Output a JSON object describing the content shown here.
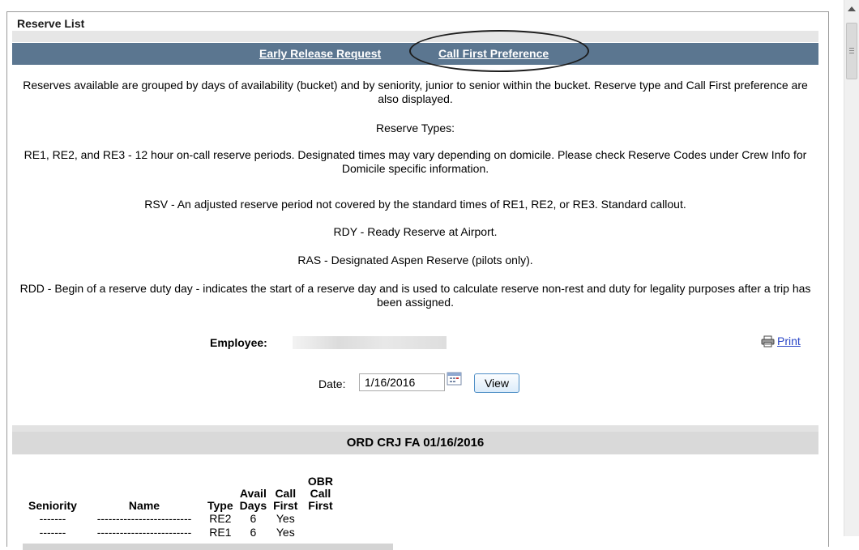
{
  "section_title": "Reserve List",
  "nav": {
    "early_release": "Early Release Request",
    "call_first": "Call First Preference"
  },
  "description": {
    "intro": "Reserves available are grouped by days of availability (bucket) and by seniority, junior to senior within the bucket. Reserve type and Call First preference are also displayed.",
    "types_heading": "Reserve Types:",
    "re_types": "RE1, RE2, and RE3 - 12 hour on-call reserve periods. Designated times may vary depending on domicile. Please check Reserve Codes under Crew Info for Domicile specific information.",
    "rsv": "RSV - An adjusted reserve period not covered by the standard times of RE1, RE2, or RE3. Standard callout.",
    "rdy": "RDY - Ready Reserve at Airport.",
    "ras": "RAS - Designated Aspen Reserve (pilots only).",
    "rdd": "RDD - Begin of a reserve duty day - indicates the start of a reserve day and is used to calculate reserve non-rest and duty for legality purposes after a trip has been assigned."
  },
  "employee": {
    "label": "Employee:"
  },
  "print_label": "Print",
  "date": {
    "label": "Date:",
    "value": "1/16/2016"
  },
  "view_button": "View",
  "report_header": "ORD CRJ FA   01/16/2016",
  "table": {
    "headers": {
      "seniority": "Seniority",
      "name": "Name",
      "type": "Type",
      "avail_top": "Avail",
      "avail_bottom": "Days",
      "call_top": "Call",
      "call_bottom": "First",
      "obr_top": "OBR Call",
      "obr_bottom": "First"
    },
    "rows": [
      {
        "seniority": "-------",
        "name": "-------------------------",
        "type": "RE2",
        "days": "6",
        "call_first": "Yes",
        "obr": ""
      },
      {
        "seniority": "-------",
        "name": "-------------------------",
        "type": "RE1",
        "days": "6",
        "call_first": "Yes",
        "obr": ""
      }
    ]
  },
  "colors": {
    "nav_bar": "#5b7690",
    "link_blue": "#2a46c7",
    "header_gray": "#d9d9d9"
  },
  "icons": [
    "printer-icon",
    "calendar-icon",
    "scroll-up-arrow-icon"
  ]
}
